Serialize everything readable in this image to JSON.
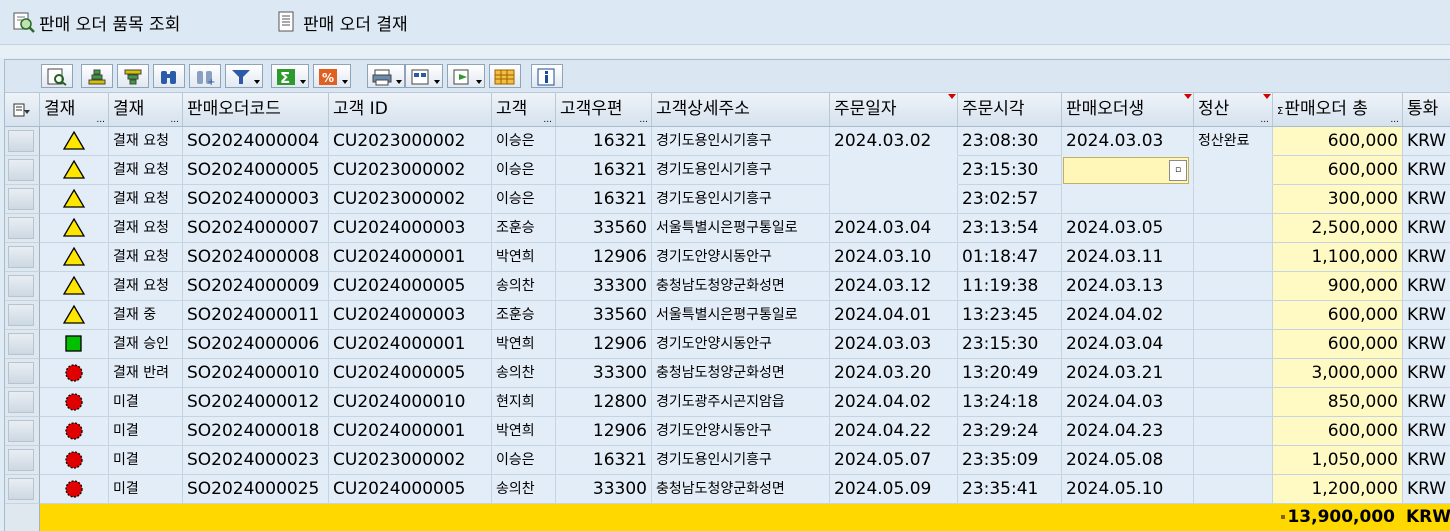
{
  "toolbar": {
    "btn_item_query": "판매 오더 품목 조회",
    "btn_approval": "판매 오더 결재"
  },
  "columns": [
    {
      "key": "approval_icon",
      "label": "결재"
    },
    {
      "key": "approval_status",
      "label": "결재"
    },
    {
      "key": "order_code",
      "label": "판매오더코드"
    },
    {
      "key": "customer_id",
      "label": "고객 ID"
    },
    {
      "key": "customer_name",
      "label": "고객"
    },
    {
      "key": "zip",
      "label": "고객우편"
    },
    {
      "key": "address",
      "label": "고객상세주소"
    },
    {
      "key": "order_date",
      "label": "주문일자"
    },
    {
      "key": "order_time",
      "label": "주문시각"
    },
    {
      "key": "created",
      "label": "판매오더생"
    },
    {
      "key": "settle",
      "label": "정산"
    },
    {
      "key": "amount",
      "label": "판매오더 총"
    },
    {
      "key": "currency",
      "label": "통화"
    }
  ],
  "rows": [
    {
      "icon": "warning",
      "status": "결재 요청",
      "code": "SO2024000004",
      "cust": "CU2023000002",
      "name": "이승은",
      "zip": "16321",
      "addr": "경기도용인시기흥구",
      "date": "2024.03.02",
      "time": "23:08:30",
      "created": "2024.03.03",
      "settle": "정산완료",
      "amount": "600,000",
      "cur": "KRW"
    },
    {
      "icon": "warning",
      "status": "결재 요청",
      "code": "SO2024000005",
      "cust": "CU2023000002",
      "name": "이승은",
      "zip": "16321",
      "addr": "경기도용인시기흥구",
      "date": "",
      "time": "23:15:30",
      "created": "",
      "settle": "",
      "amount": "600,000",
      "cur": "KRW"
    },
    {
      "icon": "warning",
      "status": "결재 요청",
      "code": "SO2024000003",
      "cust": "CU2023000002",
      "name": "이승은",
      "zip": "16321",
      "addr": "경기도용인시기흥구",
      "date": "",
      "time": "23:02:57",
      "created": "",
      "settle": "",
      "amount": "300,000",
      "cur": "KRW"
    },
    {
      "icon": "warning",
      "status": "결재 요청",
      "code": "SO2024000007",
      "cust": "CU2024000003",
      "name": "조훈승",
      "zip": "33560",
      "addr": "서울특별시은평구통일로",
      "date": "2024.03.04",
      "time": "23:13:54",
      "created": "2024.03.05",
      "settle": "",
      "amount": "2,500,000",
      "cur": "KRW"
    },
    {
      "icon": "warning",
      "status": "결재 요청",
      "code": "SO2024000008",
      "cust": "CU2024000001",
      "name": "박연희",
      "zip": "12906",
      "addr": "경기도안양시동안구",
      "date": "2024.03.10",
      "time": "01:18:47",
      "created": "2024.03.11",
      "settle": "",
      "amount": "1,100,000",
      "cur": "KRW"
    },
    {
      "icon": "warning",
      "status": "결재 요청",
      "code": "SO2024000009",
      "cust": "CU2024000005",
      "name": "송의찬",
      "zip": "33300",
      "addr": "충청남도청양군화성면",
      "date": "2024.03.12",
      "time": "11:19:38",
      "created": "2024.03.13",
      "settle": "",
      "amount": "900,000",
      "cur": "KRW"
    },
    {
      "icon": "warning",
      "status": "결재 중",
      "code": "SO2024000011",
      "cust": "CU2024000003",
      "name": "조훈승",
      "zip": "33560",
      "addr": "서울특별시은평구통일로",
      "date": "2024.04.01",
      "time": "13:23:45",
      "created": "2024.04.02",
      "settle": "",
      "amount": "600,000",
      "cur": "KRW"
    },
    {
      "icon": "green",
      "status": "결재 승인",
      "code": "SO2024000006",
      "cust": "CU2024000001",
      "name": "박연희",
      "zip": "12906",
      "addr": "경기도안양시동안구",
      "date": "2024.03.03",
      "time": "23:15:30",
      "created": "2024.03.04",
      "settle": "",
      "amount": "600,000",
      "cur": "KRW"
    },
    {
      "icon": "red",
      "status": "결재 반려",
      "code": "SO2024000010",
      "cust": "CU2024000005",
      "name": "송의찬",
      "zip": "33300",
      "addr": "충청남도청양군화성면",
      "date": "2024.03.20",
      "time": "13:20:49",
      "created": "2024.03.21",
      "settle": "",
      "amount": "3,000,000",
      "cur": "KRW"
    },
    {
      "icon": "red",
      "status": "미결",
      "code": "SO2024000012",
      "cust": "CU2024000010",
      "name": "현지희",
      "zip": "12800",
      "addr": "경기도광주시곤지암읍",
      "date": "2024.04.02",
      "time": "13:24:18",
      "created": "2024.04.03",
      "settle": "",
      "amount": "850,000",
      "cur": "KRW"
    },
    {
      "icon": "red",
      "status": "미결",
      "code": "SO2024000018",
      "cust": "CU2024000001",
      "name": "박연희",
      "zip": "12906",
      "addr": "경기도안양시동안구",
      "date": "2024.04.22",
      "time": "23:29:24",
      "created": "2024.04.23",
      "settle": "",
      "amount": "600,000",
      "cur": "KRW"
    },
    {
      "icon": "red",
      "status": "미결",
      "code": "SO2024000023",
      "cust": "CU2023000002",
      "name": "이승은",
      "zip": "16321",
      "addr": "경기도용인시기흥구",
      "date": "2024.05.07",
      "time": "23:35:09",
      "created": "2024.05.08",
      "settle": "",
      "amount": "1,050,000",
      "cur": "KRW"
    },
    {
      "icon": "red",
      "status": "미결",
      "code": "SO2024000025",
      "cust": "CU2024000005",
      "name": "송의찬",
      "zip": "33300",
      "addr": "충청남도청양군화성면",
      "date": "2024.05.09",
      "time": "23:35:41",
      "created": "2024.05.10",
      "settle": "",
      "amount": "1,200,000",
      "cur": "KRW"
    }
  ],
  "total": {
    "amount": "13,900,000",
    "currency": "KRW"
  },
  "colors": {
    "total_bar": "#ffd800",
    "amount_cell": "#fffac4",
    "warning": "#ffe600",
    "approved": "#00c000",
    "rejected": "#e00000"
  }
}
